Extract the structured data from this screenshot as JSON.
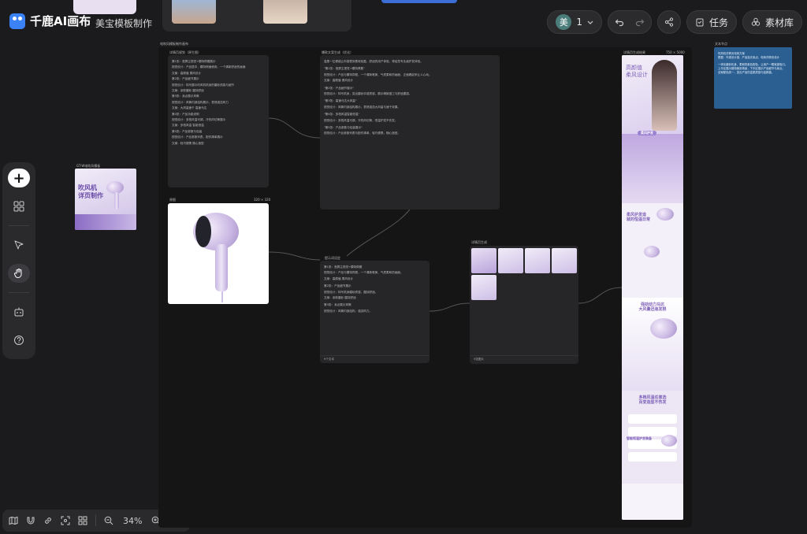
{
  "app": {
    "name": "千鹿AI画布",
    "project_title": "美宝模板制作"
  },
  "header": {
    "avatar_initial": "美",
    "collaborator_count": "1",
    "tasks_label": "任务",
    "materials_label": "素材库"
  },
  "left_toolbar": [
    "add",
    "grid",
    "select",
    "hand",
    "robot",
    "help"
  ],
  "bottom_bar": {
    "zoom": "34%"
  },
  "canvas": {
    "group_label": "电吹风模板制作画布",
    "nodes": {
      "thumb_left_label": "GT-W电吹风模板",
      "thumb_left_text": [
        "吹风机",
        "详页制作"
      ],
      "text1_label": "详情页规划（原生图）",
      "text1_lines": [
        "第1张：首屏主视觉+模特佩戴展示",
        "视觉设计：产品居中，模特侧面使用，一个清新舒适的画面",
        "文案：高颜值 柔风设计",
        "第2张：产品细节展示",
        "视觉设计：特写展示吹风机机身的磨砂质感与细节",
        "文案：亲肤磨砂 握持舒适",
        "第3张：卖点展示风筒",
        "视觉设计：风筒内部结构展示，表现强劲风力",
        "文案：大风量速干 高速马达",
        "第4张：产品功能说明",
        "视觉设计：多档风温可调，冷热风切换展示",
        "文案：多档风温 智能恒温",
        "第5张：产品参数与包装",
        "视觉设计：产品参数列表，配件清单展示",
        "文案：轻巧便携 随心造型"
      ],
      "image_label": "原图",
      "image_meta": "320 × 320",
      "text2_label": "爆款文案生成（优化）",
      "text2_lines": [
        "温柔一拉便能让你感受到柔软轻盈，舒适的用户体验，带给您专业级护发体验。",
        "\"第1张：首屏主视觉+模特佩戴\"",
        "视觉设计：产品与模特同框，一个清新唯美、气质柔和的画面，正面看起来让人心动。",
        "文案：高颜值 柔风设计",
        "\"第2张：产品细节展示\"",
        "视觉设计：特写机身，突出磨砂手感质感，展示精致做工与舒适握感。",
        "\"第3张：高速马达大风量\"",
        "视觉设计：风筒内部结构展示，表现强劲大风量与速干效果。",
        "\"第4张：多档风温智能恒温\"",
        "视觉设计：多档风温可调，冷热风切换，恒温护发不伤发。",
        "\"第5张：产品参数与包装展示\"",
        "视觉设计：产品参数列表与配件清单，轻巧便携，随心造型。"
      ],
      "text3_label": "提示词设定",
      "text3_lines": [
        "第1张：首屏主视觉+模特佩戴",
        "视觉设计：产品与模特同框，一个清新唯美、气质柔和的画面。",
        "文案：高颜值 柔风设计",
        "第2张：产品细节展示",
        "视觉设计：特写机身磨砂质感，握持舒适。",
        "文案：亲肤磨砂 握持舒适",
        "第3张：卖点展示风筒",
        "视觉设计：风筒内部结构，强劲风力。"
      ],
      "text3_footer": "9个文本",
      "gen_label": "详情页生成",
      "gen_footer": "5张图片",
      "poster_label": "详情页生成结果",
      "poster_meta": "750 × 5000",
      "poster_texts": {
        "hero_title": [
          "高颜值",
          "柔风设计"
        ],
        "hero_tag": "柔风护发",
        "sec2": [
          "柔风护发造",
          "就的恒温日常"
        ],
        "sec3": [
          "强劲动力马达",
          "大风量迅速发根"
        ],
        "sec4": [
          "多档风温任意选",
          "百变造型不伤发"
        ],
        "sec5": [
          "智能恒温护发装备"
        ]
      },
      "note_label": "文本节点",
      "note_lines": [
        "吹风机详情页电商方案",
        "根据：外观设计感、产品高光卖点、电商详情页设计",
        "一体化磨砂机身，柔和的紫色配色，让用户一眼就被吸引。",
        "上半区展示模特使用场景，下半区展示产品细节与卖点。",
        "全案配色统一，突出产品的温柔质感与高颜值。"
      ]
    }
  }
}
